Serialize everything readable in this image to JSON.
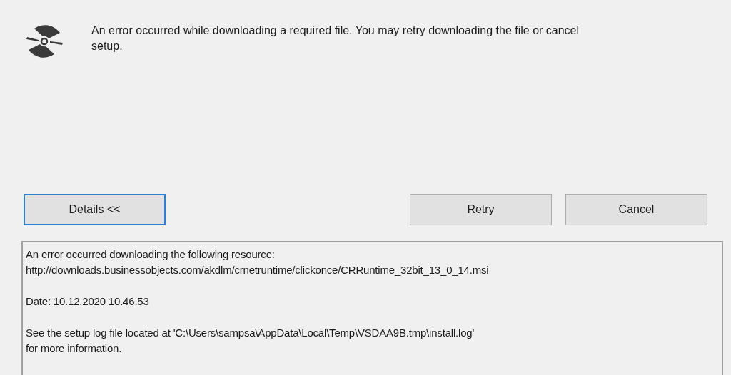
{
  "message": "An error occurred while downloading a required file. You may retry downloading the file or cancel setup.",
  "buttons": [
    {
      "label": "Details <<",
      "focused": true
    },
    {
      "label": "Retry",
      "focused": false
    },
    {
      "label": "Cancel",
      "focused": false
    }
  ],
  "details": [
    {
      "lines": [
        "An error occurred downloading the following resource:",
        "http://downloads.businessobjects.com/akdlm/crnetruntime/clickonce/CRRuntime_32bit_13_0_14.msi"
      ]
    },
    {
      "lines": [
        "Date: 10.12.2020 10.46.53"
      ]
    },
    {
      "lines": [
        "See the setup log file located at 'C:\\Users\\sampsa\\AppData\\Local\\Temp\\VSDAA9B.tmp\\install.log'",
        "for more information."
      ]
    }
  ]
}
